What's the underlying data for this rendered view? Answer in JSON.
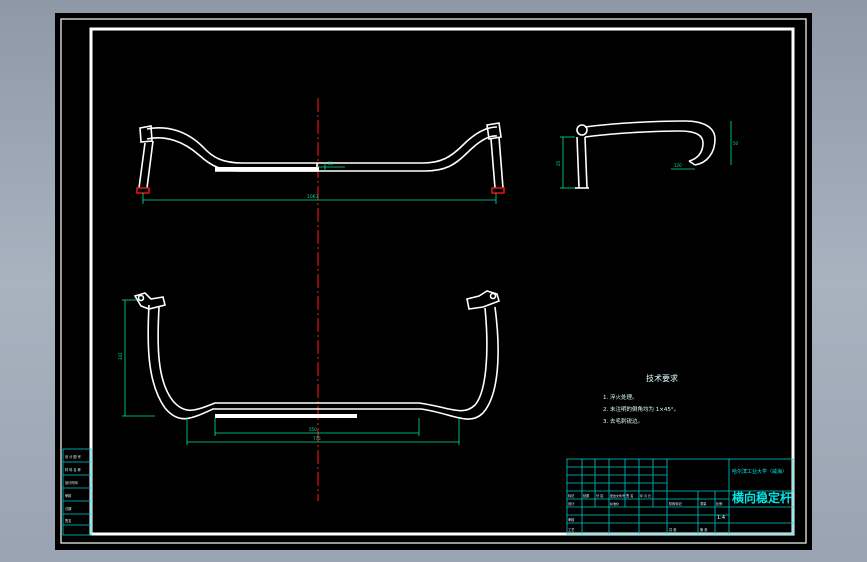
{
  "drawing": {
    "title": "横向稳定杆",
    "school": "哈尔滨工业大学（威海）",
    "scale": "1:4",
    "tech_req_title": "技术要求",
    "tech_req_items": [
      "1. 淬火处理。",
      "2. 未注明的倒角均为 1×45°。",
      "3. 去毛刺锐边。"
    ],
    "dims": {
      "top_width": "1063",
      "top_gap": "30",
      "side_height": "25",
      "side_right": "50",
      "side_bottom": "120",
      "bottom_height": "341",
      "bottom_inner": "550",
      "bottom_outer": "775"
    },
    "side_block_texts": [
      "设 计 图 号",
      "材 料 名 称",
      "设计时间",
      "审核",
      "日期",
      "签名"
    ],
    "title_block": {
      "labels": [
        "标记",
        "处数",
        "分 区",
        "更改文件号",
        "签 名",
        "年 月 日",
        "设计",
        "标准化",
        "审核",
        "工艺",
        "阶段标记",
        "重量",
        "比例",
        "共 张",
        "第 张"
      ]
    }
  },
  "colors": {
    "frame": "#ffffff",
    "centerline": "#e01414",
    "dimension": "#00e5a0",
    "tableline": "#00c8d0",
    "text": "#00e5e5"
  }
}
